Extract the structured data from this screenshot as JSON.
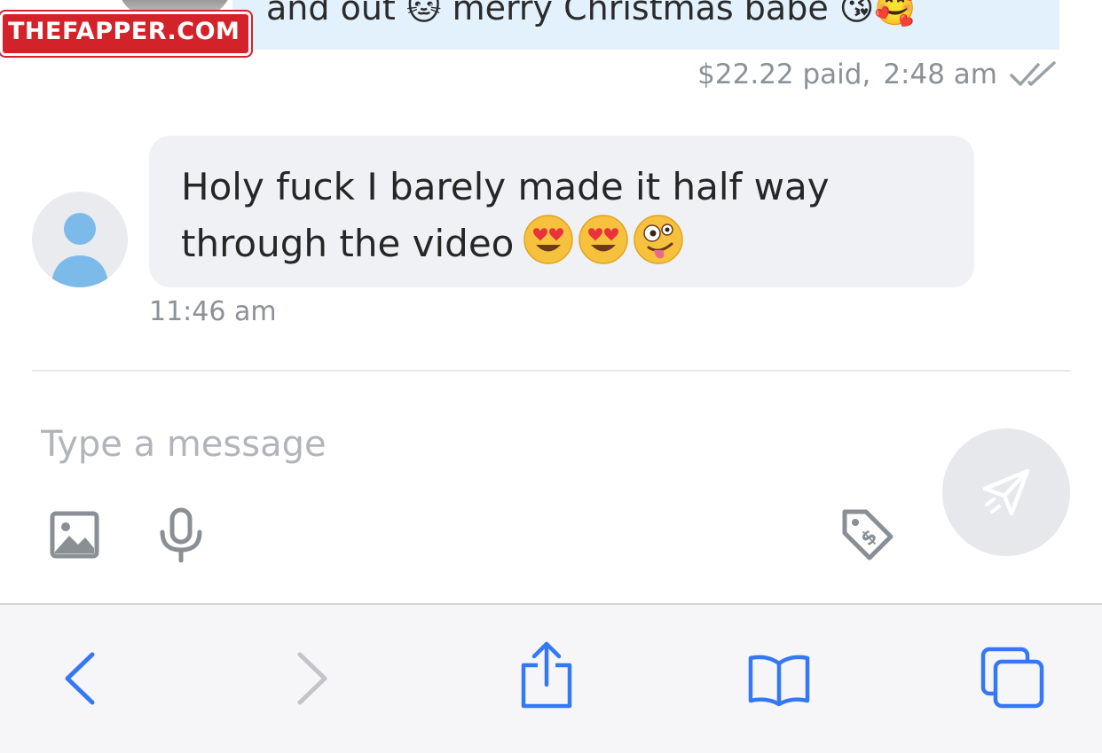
{
  "watermark": {
    "text": "THEFAPPER.COM"
  },
  "conversation": {
    "outgoing": {
      "text": "and out 🐱 merry Christmas babe 😘🥰",
      "meta": "$22.22 paid,",
      "time": "2:48 am",
      "status_icon": "double-check-icon"
    },
    "incoming": {
      "line1": "Holy fuck I barely made it half way",
      "line2": "through the video",
      "emojis": [
        "heart-eyes-emoji",
        "heart-eyes-emoji",
        "zany-face-emoji"
      ],
      "time": "11:46 am",
      "avatar_icon": "default-user-avatar-icon"
    }
  },
  "composer": {
    "placeholder": "Type a message",
    "value": "",
    "tools": [
      "image-icon",
      "microphone-icon",
      "price-tag-icon"
    ],
    "send_icon": "send-icon"
  },
  "browser_toolbar": {
    "buttons": [
      "back-icon",
      "forward-icon",
      "share-icon",
      "bookmarks-icon",
      "tabs-icon"
    ],
    "accent": "#3478f6",
    "disabled": "#c4c4c8"
  },
  "colors": {
    "outgoing_bubble": "#e3f1fc",
    "incoming_bubble": "#f0f1f4",
    "meta_text": "#8a9199",
    "watermark_bg": "#d3222a"
  }
}
